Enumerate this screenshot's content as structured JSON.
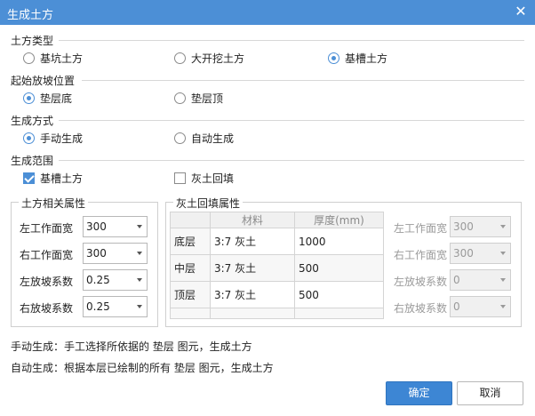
{
  "window": {
    "title": "生成土方",
    "close_icon": "close-icon"
  },
  "earthwork_type": {
    "title": "土方类型",
    "options": [
      "基坑土方",
      "大开挖土方",
      "基槽土方"
    ],
    "selected": "基槽土方"
  },
  "slope_start": {
    "title": "起始放坡位置",
    "options": [
      "垫层底",
      "垫层顶"
    ],
    "selected": "垫层底"
  },
  "generation_mode": {
    "title": "生成方式",
    "options": [
      "手动生成",
      "自动生成"
    ],
    "selected": "手动生成"
  },
  "generation_scope": {
    "title": "生成范围",
    "options": [
      {
        "label": "基槽土方",
        "checked": true
      },
      {
        "label": "灰土回填",
        "checked": false
      }
    ]
  },
  "earthwork_props": {
    "title": "土方相关属性",
    "fields": [
      {
        "label": "左工作面宽",
        "value": "300"
      },
      {
        "label": "右工作面宽",
        "value": "300"
      },
      {
        "label": "左放坡系数",
        "value": "0.25"
      },
      {
        "label": "右放坡系数",
        "value": "0.25"
      }
    ]
  },
  "backfill_props": {
    "title": "灰土回填属性",
    "columns": [
      "材料",
      "厚度(mm)"
    ],
    "rows": [
      {
        "layer": "底层",
        "material": "3:7 灰土",
        "thickness": "1000"
      },
      {
        "layer": "中层",
        "material": "3:7 灰土",
        "thickness": "500"
      },
      {
        "layer": "顶层",
        "material": "3:7 灰土",
        "thickness": "500"
      }
    ],
    "fields": [
      {
        "label": "左工作面宽",
        "value": "300"
      },
      {
        "label": "右工作面宽",
        "value": "300"
      },
      {
        "label": "左放坡系数",
        "value": "0"
      },
      {
        "label": "右放坡系数",
        "value": "0"
      }
    ]
  },
  "notes": [
    "手动生成：手工选择所依据的 垫层 图元，生成土方",
    "自动生成：根据本层已绘制的所有 垫层 图元，生成土方"
  ],
  "buttons": {
    "ok": "确定",
    "cancel": "取消"
  },
  "colors": {
    "accent": "#4c8fd6",
    "primary_button": "#3d86d4"
  }
}
